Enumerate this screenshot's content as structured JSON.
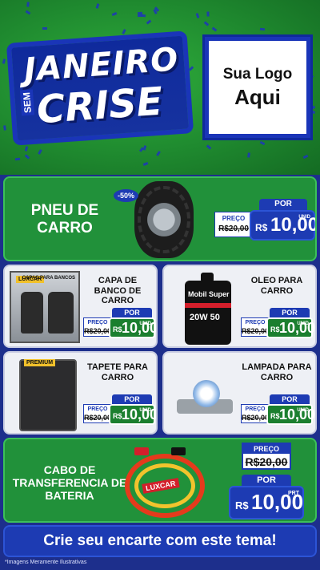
{
  "header": {
    "title_line1": "JANEIRO",
    "title_sem": "SEM",
    "title_line2": "CRISE",
    "logo_line1": "Sua Logo",
    "logo_line2": "Aqui"
  },
  "colors": {
    "green": "#21913a",
    "blue": "#1d3bb3",
    "light_panel": "#eef0f5"
  },
  "products": {
    "pneu": {
      "name": "PNEU DE CARRO",
      "discount": "-50%",
      "preco_label": "PREÇO",
      "old_price": "R$20,00",
      "por_label": "POR",
      "currency": "R$",
      "price": "10,00",
      "unit": "UNID",
      "image": "tire-icon"
    },
    "capa": {
      "name": "CAPA DE BANCO DE CARRO",
      "preco_label": "PREÇO",
      "old_price": "R$20,00",
      "por_label": "POR",
      "currency": "R$",
      "price": "10,00",
      "unit": "UNID",
      "box_label": "CAPAS PARA BANCOS",
      "brand": "LUXCAR",
      "image": "seat-cover-icon"
    },
    "oleo": {
      "name": "OLEO PARA CARRO",
      "preco_label": "PREÇO",
      "old_price": "R$20,00",
      "por_label": "POR",
      "currency": "R$",
      "price": "10,00",
      "unit": "UNID",
      "brand": "Mobil Super",
      "visc": "20W 50",
      "image": "oil-bottle-icon"
    },
    "tapete": {
      "name": "TAPETE PARA CARRO",
      "preco_label": "PREÇO",
      "old_price": "R$20,00",
      "por_label": "POR",
      "currency": "R$",
      "price": "10,00",
      "unit": "UNID",
      "box_label": "PREMIUM",
      "image": "car-mat-icon"
    },
    "lampada": {
      "name": "LAMPADA PARA CARRO",
      "preco_label": "PREÇO",
      "old_price": "R$20,00",
      "por_label": "POR",
      "currency": "R$",
      "price": "10,00",
      "unit": "UNID",
      "image": "headlight-bulb-icon"
    },
    "cabo": {
      "name": "CABO DE TRANSFERENCIA DE BATERIA",
      "preco_label": "PREÇO",
      "old_price": "R$20,00",
      "por_label": "POR",
      "currency": "R$",
      "price": "10,00",
      "unit": "PRT",
      "brand": "LUXCAR",
      "image": "jumper-cables-icon"
    }
  },
  "footer": {
    "cta": "Crie seu encarte com este tema!",
    "disclaimer": "*Imagens Meramente Ilustrativas"
  }
}
